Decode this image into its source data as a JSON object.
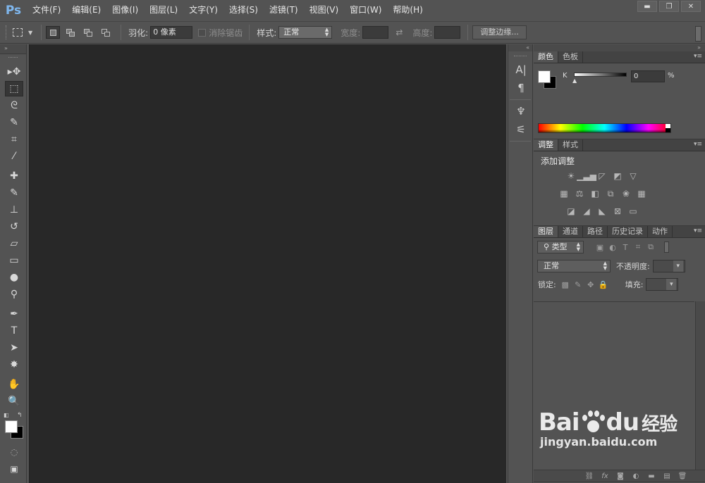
{
  "app": {
    "logo": "Ps"
  },
  "menu": [
    "文件(F)",
    "编辑(E)",
    "图像(I)",
    "图层(L)",
    "文字(Y)",
    "选择(S)",
    "滤镜(T)",
    "视图(V)",
    "窗口(W)",
    "帮助(H)"
  ],
  "window_controls": {
    "minimize": "▬",
    "maximize": "❐",
    "close": "✕"
  },
  "options": {
    "feather_label": "羽化:",
    "feather_value": "0 像素",
    "antialias_label": "消除锯齿",
    "style_label": "样式:",
    "style_value": "正常",
    "width_label": "宽度:",
    "height_label": "高度:",
    "refine_edge": "调整边缘..."
  },
  "toolbar": {
    "collapse": "»",
    "tools": [
      {
        "name": "move-tool",
        "glyph": "▸✥"
      },
      {
        "name": "rect-marquee-tool",
        "glyph": "⬚"
      },
      {
        "name": "lasso-tool",
        "glyph": "ᘓ"
      },
      {
        "name": "quick-select-tool",
        "glyph": "✎"
      },
      {
        "name": "crop-tool",
        "glyph": "⌗"
      },
      {
        "name": "eyedropper-tool",
        "glyph": "⁄"
      },
      {
        "name": "healing-brush-tool",
        "glyph": "✚"
      },
      {
        "name": "brush-tool",
        "glyph": "✎"
      },
      {
        "name": "clone-stamp-tool",
        "glyph": "⊥"
      },
      {
        "name": "history-brush-tool",
        "glyph": "↺"
      },
      {
        "name": "eraser-tool",
        "glyph": "▱"
      },
      {
        "name": "gradient-tool",
        "glyph": "▭"
      },
      {
        "name": "blur-tool",
        "glyph": "●"
      },
      {
        "name": "dodge-tool",
        "glyph": "⚲"
      },
      {
        "name": "pen-tool",
        "glyph": "✒"
      },
      {
        "name": "type-tool",
        "glyph": "T"
      },
      {
        "name": "path-select-tool",
        "glyph": "➤"
      },
      {
        "name": "custom-shape-tool",
        "glyph": "✸"
      },
      {
        "name": "hand-tool",
        "glyph": "✋"
      },
      {
        "name": "zoom-tool",
        "glyph": "🔍"
      }
    ],
    "quick_mask": "◌",
    "screen_mode": "▣"
  },
  "dock": {
    "collapse": "«",
    "icons": [
      {
        "name": "character-panel-icon",
        "glyph": "A|"
      },
      {
        "name": "paragraph-panel-icon",
        "glyph": "¶"
      },
      {
        "name": "tool-presets-icon",
        "glyph": "♆"
      },
      {
        "name": "brush-presets-icon",
        "glyph": "⚟"
      }
    ]
  },
  "panels": {
    "collapse": "»",
    "color": {
      "tabs": [
        "颜色",
        "色板"
      ],
      "k_label": "K",
      "k_value": "0",
      "pct": "%"
    },
    "adjustments": {
      "tabs": [
        "调整",
        "样式"
      ],
      "title": "添加调整"
    },
    "layers": {
      "tabs": [
        "图层",
        "通道",
        "路径",
        "历史记录",
        "动作"
      ],
      "filter_kind": "类型",
      "blend_mode": "正常",
      "opacity_label": "不透明度:",
      "lock_label": "锁定:",
      "fill_label": "填充:"
    }
  },
  "watermark": {
    "brand_a": "Bai",
    "brand_b": "du",
    "brand_cn": "经验",
    "url": "jingyan.baidu.com"
  }
}
